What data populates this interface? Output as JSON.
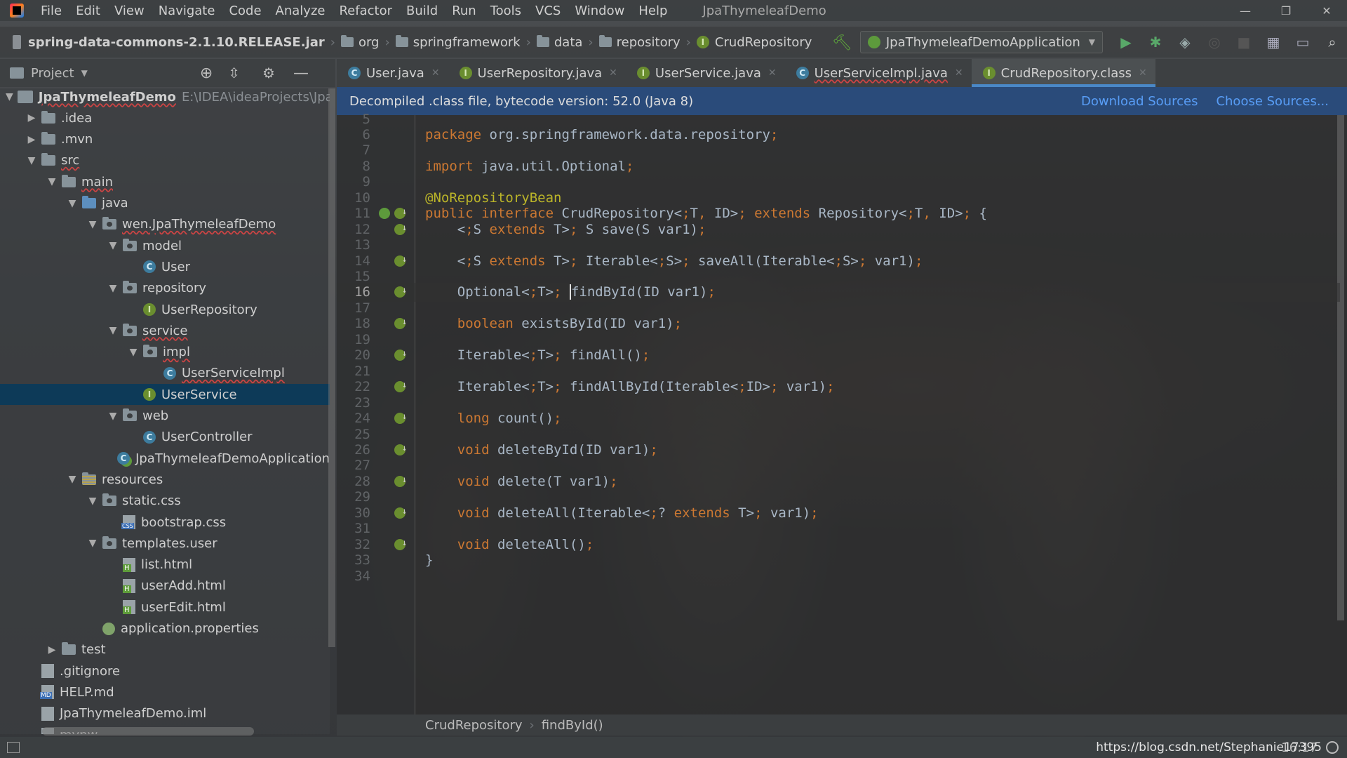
{
  "menubar": {
    "items": [
      "File",
      "Edit",
      "View",
      "Navigate",
      "Code",
      "Analyze",
      "Refactor",
      "Build",
      "Run",
      "Tools",
      "VCS",
      "Window",
      "Help"
    ],
    "title": "JpaThymeleafDemo"
  },
  "navbar": {
    "crumbs": [
      "spring-data-commons-2.1.10.RELEASE.jar",
      "org",
      "springframework",
      "data",
      "repository",
      "CrudRepository"
    ],
    "run_config": "JpaThymeleafDemoApplication"
  },
  "project": {
    "header": "Project",
    "tree": [
      {
        "label": "JpaThymeleafDemo",
        "extra": "E:\\IDEA\\ideaProjects\\JpaThym",
        "icon": "module-icon",
        "arrow": "▼",
        "depth": 0
      },
      {
        "label": ".idea",
        "icon": "folder-icon",
        "arrow": "▶",
        "depth": 1
      },
      {
        "label": ".mvn",
        "icon": "folder-icon",
        "arrow": "▶",
        "depth": 1
      },
      {
        "label": "src",
        "icon": "folder-icon",
        "arrow": "▼",
        "depth": 1
      },
      {
        "label": "main",
        "icon": "folder-icon",
        "arrow": "▼",
        "depth": 2
      },
      {
        "label": "java",
        "icon": "source-folder-icon",
        "arrow": "▼",
        "depth": 3
      },
      {
        "label": "wen.JpaThymeleafDemo",
        "icon": "package-icon",
        "arrow": "▼",
        "depth": 4
      },
      {
        "label": "model",
        "icon": "package-icon",
        "arrow": "▼",
        "depth": 5
      },
      {
        "label": "User",
        "icon": "class-icon",
        "arrow": "",
        "depth": 6
      },
      {
        "label": "repository",
        "icon": "package-icon",
        "arrow": "▼",
        "depth": 5
      },
      {
        "label": "UserRepository",
        "icon": "interface-icon",
        "arrow": "",
        "depth": 6
      },
      {
        "label": "service",
        "icon": "package-icon",
        "arrow": "▼",
        "depth": 5
      },
      {
        "label": "impl",
        "icon": "package-icon",
        "arrow": "▼",
        "depth": 6
      },
      {
        "label": "UserServiceImpl",
        "icon": "class-icon",
        "arrow": "",
        "depth": 7
      },
      {
        "label": "UserService",
        "icon": "interface-icon",
        "arrow": "",
        "depth": 6
      },
      {
        "label": "web",
        "icon": "package-icon",
        "arrow": "▼",
        "depth": 5
      },
      {
        "label": "UserController",
        "icon": "class-icon",
        "arrow": "",
        "depth": 6
      },
      {
        "label": "JpaThymeleafDemoApplication",
        "icon": "spring-boot-class-icon",
        "arrow": "",
        "depth": 5
      },
      {
        "label": "resources",
        "icon": "resources-folder-icon",
        "arrow": "▼",
        "depth": 3
      },
      {
        "label": "static.css",
        "icon": "package-icon",
        "arrow": "▼",
        "depth": 4
      },
      {
        "label": "bootstrap.css",
        "icon": "css-file-icon",
        "arrow": "",
        "depth": 5
      },
      {
        "label": "templates.user",
        "icon": "package-icon",
        "arrow": "▼",
        "depth": 4
      },
      {
        "label": "list.html",
        "icon": "html-file-icon",
        "arrow": "",
        "depth": 5
      },
      {
        "label": "userAdd.html",
        "icon": "html-file-icon",
        "arrow": "",
        "depth": 5
      },
      {
        "label": "userEdit.html",
        "icon": "html-file-icon",
        "arrow": "",
        "depth": 5
      },
      {
        "label": "application.properties",
        "icon": "properties-file-icon",
        "arrow": "",
        "depth": 4
      },
      {
        "label": "test",
        "icon": "folder-icon",
        "arrow": "▶",
        "depth": 2
      },
      {
        "label": ".gitignore",
        "icon": "file-icon",
        "arrow": "",
        "depth": 1
      },
      {
        "label": "HELP.md",
        "icon": "md-file-icon",
        "arrow": "",
        "depth": 1
      },
      {
        "label": "JpaThymeleafDemo.iml",
        "icon": "file-icon",
        "arrow": "",
        "depth": 1
      },
      {
        "label": "mvnw",
        "icon": "file-icon",
        "arrow": "",
        "depth": 1
      }
    ],
    "selected": "UserService"
  },
  "tabs": [
    {
      "label": "User.java",
      "icon": "class-icon"
    },
    {
      "label": "UserRepository.java",
      "icon": "interface-icon"
    },
    {
      "label": "UserService.java",
      "icon": "interface-icon"
    },
    {
      "label": "UserServiceImpl.java",
      "icon": "class-icon"
    },
    {
      "label": "CrudRepository.class",
      "icon": "interface-icon",
      "active": true
    }
  ],
  "banner": {
    "message": "Decompiled .class file, bytecode version: 52.0 (Java 8)",
    "download_sources": "Download Sources",
    "choose_sources": "Choose Sources..."
  },
  "editor": {
    "current_line": 16,
    "lines": [
      {
        "n": 5,
        "code": ""
      },
      {
        "n": 6,
        "code": "package org.springframework.data.repository;"
      },
      {
        "n": 7,
        "code": ""
      },
      {
        "n": 8,
        "code": "import java.util.Optional;"
      },
      {
        "n": 9,
        "code": ""
      },
      {
        "n": 10,
        "code": "@NoRepositoryBean"
      },
      {
        "n": 11,
        "code": "public interface CrudRepository<T, ID> extends Repository<T, ID> {",
        "gutter": "implemented-overridden"
      },
      {
        "n": 12,
        "code": "    <S extends T> S save(S var1);",
        "gutter": "implemented"
      },
      {
        "n": 13,
        "code": ""
      },
      {
        "n": 14,
        "code": "    <S extends T> Iterable<S> saveAll(Iterable<S> var1);",
        "gutter": "implemented"
      },
      {
        "n": 15,
        "code": ""
      },
      {
        "n": 16,
        "code": "    Optional<T> findById(ID var1);",
        "gutter": "implemented"
      },
      {
        "n": 17,
        "code": ""
      },
      {
        "n": 18,
        "code": "    boolean existsById(ID var1);",
        "gutter": "implemented"
      },
      {
        "n": 19,
        "code": ""
      },
      {
        "n": 20,
        "code": "    Iterable<T> findAll();",
        "gutter": "implemented"
      },
      {
        "n": 21,
        "code": ""
      },
      {
        "n": 22,
        "code": "    Iterable<T> findAllById(Iterable<ID> var1);",
        "gutter": "implemented"
      },
      {
        "n": 23,
        "code": ""
      },
      {
        "n": 24,
        "code": "    long count();",
        "gutter": "implemented"
      },
      {
        "n": 25,
        "code": ""
      },
      {
        "n": 26,
        "code": "    void deleteById(ID var1);",
        "gutter": "implemented"
      },
      {
        "n": 27,
        "code": ""
      },
      {
        "n": 28,
        "code": "    void delete(T var1);",
        "gutter": "implemented"
      },
      {
        "n": 29,
        "code": ""
      },
      {
        "n": 30,
        "code": "    void deleteAll(Iterable<? extends T> var1);",
        "gutter": "implemented"
      },
      {
        "n": 31,
        "code": ""
      },
      {
        "n": 32,
        "code": "    void deleteAll();",
        "gutter": "implemented"
      },
      {
        "n": 33,
        "code": "}"
      },
      {
        "n": 34,
        "code": ""
      }
    ]
  },
  "editor_breadcrumb": [
    "CrudRepository",
    "findById()"
  ],
  "statusbar": {
    "position": "16:17",
    "watermark": "https://blog.csdn.net/Stephanie17395"
  },
  "colors": {
    "keyword": "#cc7832",
    "annotation": "#bbb529",
    "link": "#589df6",
    "selection": "#0d3a58",
    "banner": "#294c7c"
  }
}
